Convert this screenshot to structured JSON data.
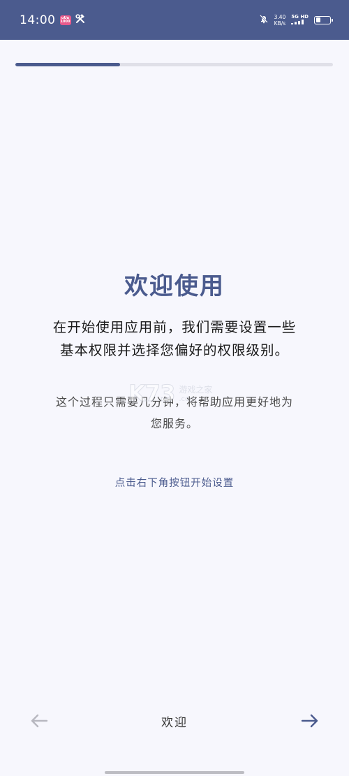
{
  "status_bar": {
    "time": "14:00",
    "app_badge_top": "uUu",
    "app_badge_bottom": "1000",
    "tool_icon": "hammer-wrench-icon",
    "mute_icon": "bell-off-icon",
    "net_speed_value": "3.40",
    "net_speed_unit": "KB/s",
    "signal_top": "5G HD",
    "battery_level": 0.35,
    "background": "#4b5b8e"
  },
  "progress": {
    "fraction": 0.33,
    "color": "#4b5b8e"
  },
  "main": {
    "title": "欢迎使用",
    "lead_line1": "在开始使用应用前，我们需要设置一些",
    "lead_line2": "基本权限并选择您偏好的权限级别。",
    "sub_line1": "这个过程只需要几分钟，将帮助应用更好地为",
    "sub_line2": "您服务。",
    "hint": "点击右下角按钮开始设置"
  },
  "watermark": {
    "logo": "K73",
    "name": "游戏之家",
    "url": ".com"
  },
  "bottom_nav": {
    "back_icon": "arrow-left-icon",
    "label": "欢迎",
    "next_icon": "arrow-right-icon",
    "back_color": "#b8b8c0",
    "next_color": "#4b5b8e"
  }
}
